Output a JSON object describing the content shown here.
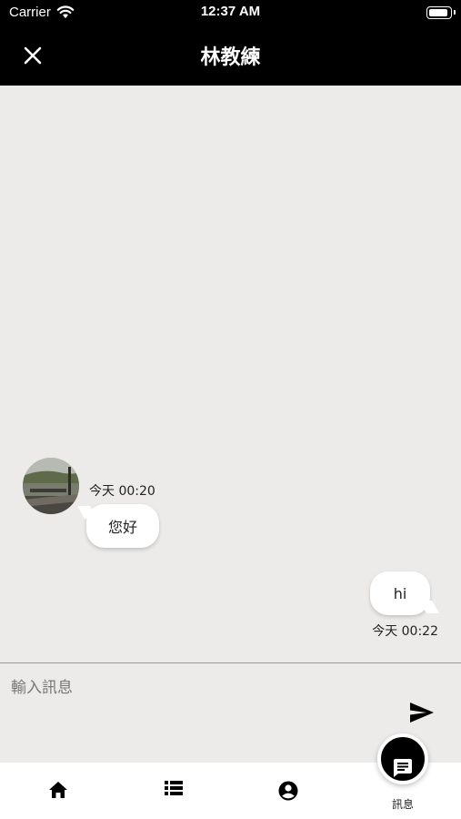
{
  "status_bar": {
    "carrier": "Carrier",
    "time": "12:37 AM",
    "battery_level": 1.0
  },
  "app_bar": {
    "title": "林教練",
    "close_icon": "close-icon"
  },
  "messages": [
    {
      "side": "left",
      "time": "今天 00:20",
      "text": "您好",
      "has_avatar": true
    },
    {
      "side": "right",
      "time": "今天 00:22",
      "text": "hi",
      "has_avatar": false
    }
  ],
  "composer": {
    "placeholder": "輸入訊息",
    "value": "",
    "send_icon": "send-icon"
  },
  "bottom_nav": {
    "items": [
      {
        "icon": "home-icon",
        "label": ""
      },
      {
        "icon": "list-icon",
        "label": ""
      },
      {
        "icon": "account-circle-icon",
        "label": ""
      },
      {
        "icon": "chat-icon",
        "label": "訊息",
        "active": true
      }
    ]
  },
  "colors": {
    "bar": "#000000",
    "chat_bg": "#ecebea",
    "bubble": "#ffffff",
    "nav_bg": "#ffffff"
  }
}
